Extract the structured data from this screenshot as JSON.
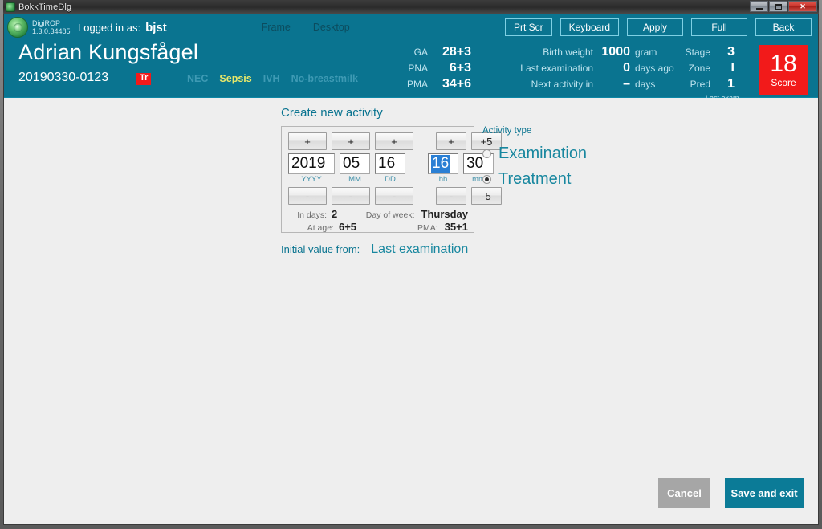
{
  "window": {
    "title": "BokkTimeDlg",
    "minimize_label": "minimize",
    "maximize_label": "maximize",
    "close_label": "✕"
  },
  "navbar": {
    "app_name": "DigiROP",
    "app_version": "1.3.0.34485",
    "logged_in_label": "Logged in as:",
    "logged_in_user": "bjst",
    "links": [
      {
        "label": "Frame"
      },
      {
        "label": "Desktop"
      }
    ],
    "buttons": [
      {
        "label": "Prt Scr"
      },
      {
        "label": "Keyboard"
      },
      {
        "label": "Apply"
      },
      {
        "label": "Full"
      },
      {
        "label": "Back"
      }
    ]
  },
  "patient": {
    "name": "Adrian Kungsfågel",
    "id": "20190330-0123",
    "badge": "Tr",
    "conditions": [
      {
        "label": "NEC",
        "active": false
      },
      {
        "label": "Sepsis",
        "active": true
      },
      {
        "label": "IVH",
        "active": false
      },
      {
        "label": "No-breastmilk",
        "active": false
      }
    ],
    "ages": [
      {
        "label": "GA",
        "value": "28+3"
      },
      {
        "label": "PNA",
        "value": "6+3"
      },
      {
        "label": "PMA",
        "value": "34+6"
      }
    ],
    "measures": [
      {
        "label": "Birth weight",
        "value": "1000",
        "unit": "gram"
      },
      {
        "label": "Last examination",
        "value": "0",
        "unit": "days ago"
      },
      {
        "label": "Next activity in",
        "value": "–",
        "unit": "days"
      }
    ],
    "exam": [
      {
        "label": "Stage",
        "value": "3"
      },
      {
        "label": "Zone",
        "value": "I"
      },
      {
        "label": "Pred",
        "value": "1"
      }
    ],
    "exam_note": "Last exam.",
    "score_value": "18",
    "score_label": "Score"
  },
  "main": {
    "section_title": "Create new activity",
    "picker": {
      "increment_buttons": [
        {
          "label": "+",
          "target": "YYYY"
        },
        {
          "label": "+",
          "target": "MM"
        },
        {
          "label": "+",
          "target": "DD"
        },
        {
          "label": "+",
          "target": "hh"
        },
        {
          "label": "+5",
          "target": "mm"
        }
      ],
      "decrement_buttons": [
        {
          "label": "-",
          "target": "YYYY"
        },
        {
          "label": "-",
          "target": "MM"
        },
        {
          "label": "-",
          "target": "DD"
        },
        {
          "label": "-",
          "target": "hh"
        },
        {
          "label": "-5",
          "target": "mm"
        }
      ],
      "fields": [
        {
          "value": "2019",
          "label": "YYYY",
          "selected": false
        },
        {
          "value": "05",
          "label": "MM",
          "selected": false
        },
        {
          "value": "16",
          "label": "DD",
          "selected": false
        },
        {
          "value": "16",
          "label": "hh",
          "selected": true
        },
        {
          "value": "30",
          "label": "mm",
          "selected": false
        }
      ],
      "summary": {
        "in_days_label": "In days:",
        "in_days_value": "2",
        "at_age_label": "At age:",
        "at_age_value": "6+5",
        "day_of_week_label": "Day of week:",
        "day_of_week_value": "Thursday",
        "pma_label": "PMA:",
        "pma_value": "35+1"
      }
    },
    "activity_type": {
      "label": "Activity type",
      "options": [
        {
          "label": "Examination",
          "selected": false
        },
        {
          "label": "Treatment",
          "selected": true
        }
      ]
    },
    "initial_value_label": "Initial value from:",
    "initial_value": "Last examination"
  },
  "footer": {
    "cancel_label": "Cancel",
    "save_label": "Save and exit"
  },
  "colors": {
    "teal_header": "#0a7490",
    "teal_text": "#18879f",
    "alert_red": "#f21a1a",
    "selection_blue": "#2a7fd4",
    "highlight_yellow": "#e8e86a"
  }
}
